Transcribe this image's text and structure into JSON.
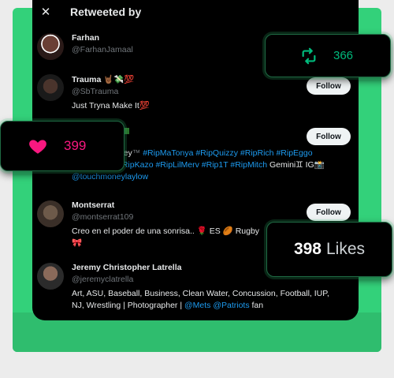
{
  "header": {
    "title": "Retweeted by"
  },
  "users": [
    {
      "name": "Farhan",
      "handle": "@FarhanJamaal",
      "bio": ""
    },
    {
      "name": "Trauma",
      "emoji": "🤘🏾💸💯",
      "handle": "@SbTrauma",
      "bio": "Just Tryna Make It💯",
      "follow": "Follow"
    },
    {
      "name": "",
      "handle": "",
      "bio_pre": "oney",
      "bio_mark": "™",
      "bio_links_1": "#RipMaTonya #RipQuizzy #RipRich #RipEggo",
      "bio_links_2_pre": "#RipKazo #RipLilMerv #Rip1T #RipMitch",
      "bio_gemini": "Gemini♊ IG📸",
      "bio_links_3": "@touchmoneylaylow",
      "follow": "Follow"
    },
    {
      "name": "Montserrat",
      "handle": "@montserrat109",
      "bio": "Creo en el poder de una sonrisa.. ",
      "bio_rose": "🌹",
      "bio_es": " ES ",
      "bio_ball": "🏉",
      "bio_rugby": " Rugby",
      "bio_bow": "🎀",
      "follow": "Follow"
    },
    {
      "name": "Jeremy Christopher Latrella",
      "handle": "@jeremyclatrella",
      "bio_1": "Art, ASU, Baseball, Business, Clean Water, Concussion, Football, IUP,",
      "bio_2_pre": "NJ, Wrestling | Photographer | ",
      "bio_2_link": "@Mets @Patriots",
      "bio_2_post": " fan"
    }
  ],
  "stats": {
    "retweets": {
      "icon": "retweet-icon",
      "count": "366",
      "color": "#00ba7c"
    },
    "likes": {
      "icon": "heart-icon",
      "count": "399",
      "color": "#f91880"
    },
    "likes_total": {
      "number": "398",
      "label": "Likes"
    }
  },
  "colors": {
    "accent_green": "#33d17a",
    "link": "#1d9bf0",
    "background": "#000000"
  }
}
